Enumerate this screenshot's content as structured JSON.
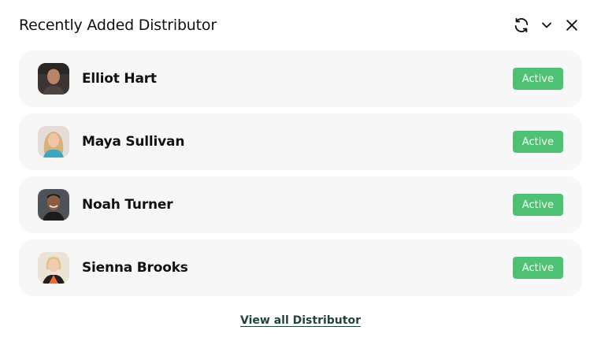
{
  "widget": {
    "title": "Recently Added Distributor",
    "actions": {
      "refresh_icon": "refresh-icon",
      "collapse_icon": "chevron-down-icon",
      "close_icon": "close-icon"
    }
  },
  "distributors": [
    {
      "name": "Elliot Hart",
      "status": "Active",
      "avatar_icon": "avatar-elliot"
    },
    {
      "name": "Maya Sullivan",
      "status": "Active",
      "avatar_icon": "avatar-maya"
    },
    {
      "name": "Noah Turner",
      "status": "Active",
      "avatar_icon": "avatar-noah"
    },
    {
      "name": "Sienna Brooks",
      "status": "Active",
      "avatar_icon": "avatar-sienna"
    }
  ],
  "footer": {
    "link_label": "View all Distributor"
  },
  "colors": {
    "row_bg": "#f7f7f7",
    "status_active": "#4cc272",
    "link": "#1f4738"
  }
}
